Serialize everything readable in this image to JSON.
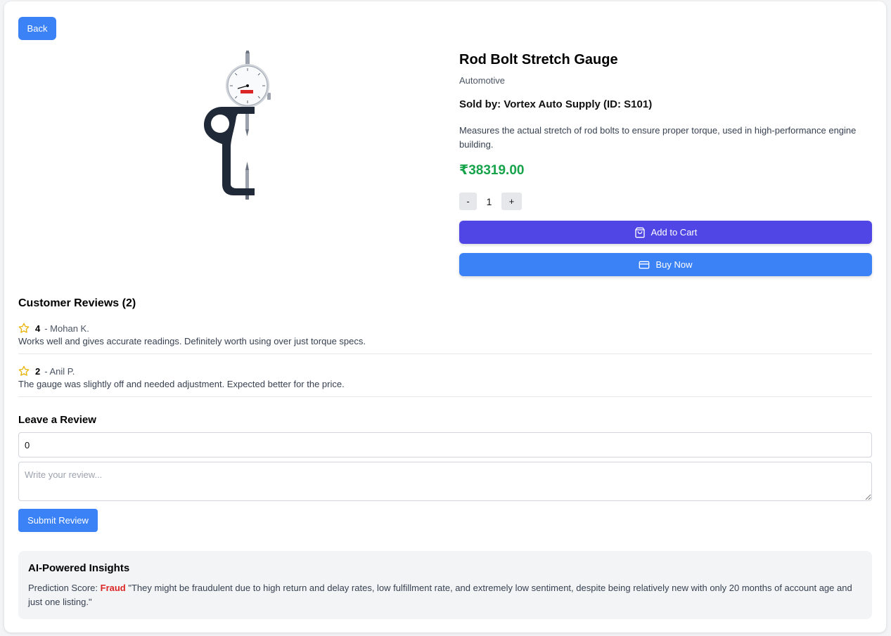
{
  "nav": {
    "back_label": "Back"
  },
  "product": {
    "title": "Rod Bolt Stretch Gauge",
    "category": "Automotive",
    "seller": "Sold by: Vortex Auto Supply (ID: S101)",
    "description": "Measures the actual stretch of rod bolts to ensure proper torque, used in high-performance engine building.",
    "price": "₹38319.00",
    "image_icon": "dial-gauge-image"
  },
  "quantity": {
    "minus_label": "-",
    "value": "1",
    "plus_label": "+"
  },
  "actions": {
    "add_to_cart_label": "Add to Cart",
    "add_to_cart_icon": "shopping-bag-icon",
    "buy_now_label": "Buy Now",
    "buy_now_icon": "credit-card-icon"
  },
  "reviews": {
    "heading": "Customer Reviews (2)",
    "items": [
      {
        "rating": "4",
        "reviewer": "- Mohan K.",
        "text": "Works well and gives accurate readings. Definitely worth using over just torque specs."
      },
      {
        "rating": "2",
        "reviewer": "- Anil P.",
        "text": "The gauge was slightly off and needed adjustment. Expected better for the price."
      }
    ]
  },
  "review_form": {
    "heading": "Leave a Review",
    "rating_value": "0",
    "textarea_placeholder": "Write your review...",
    "submit_label": "Submit Review"
  },
  "insights": {
    "title": "AI-Powered Insights",
    "score_label": "Prediction Score:",
    "score_value": "Fraud",
    "explanation": "\"They might be fraudulent due to high return and delay rates, low fulfillment rate, and extremely low sentiment, despite being relatively new with only 20 months of account age and just one listing.\""
  },
  "colors": {
    "primary": "#3b82f6",
    "add_to_cart": "#4f46e5",
    "price": "#16a34a",
    "fraud": "#dc2626",
    "star": "#eab308"
  }
}
